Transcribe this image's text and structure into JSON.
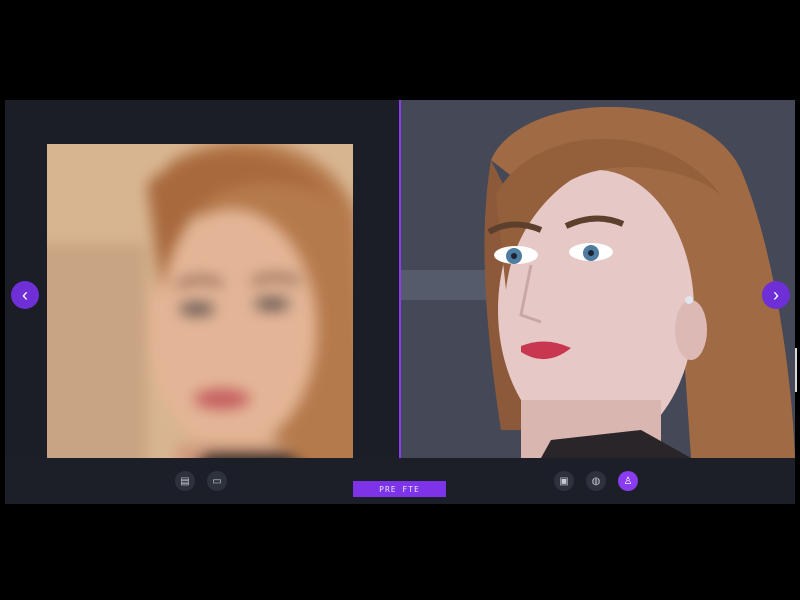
{
  "viewer": {
    "compare_label": "PRE FTE",
    "nav": {
      "prev_glyph": "‹",
      "next_glyph": "›"
    },
    "left_tools": [
      {
        "name": "crop-icon",
        "glyph": "▤"
      },
      {
        "name": "adjust-icon",
        "glyph": "▭"
      }
    ],
    "right_tools": [
      {
        "name": "frame-icon",
        "glyph": "▣"
      },
      {
        "name": "filter-icon",
        "glyph": "◍"
      },
      {
        "name": "magic-icon",
        "glyph": "♙"
      }
    ]
  },
  "colors": {
    "accent": "#8a3cf0",
    "panel": "#1c1f28",
    "background": "#000000"
  }
}
